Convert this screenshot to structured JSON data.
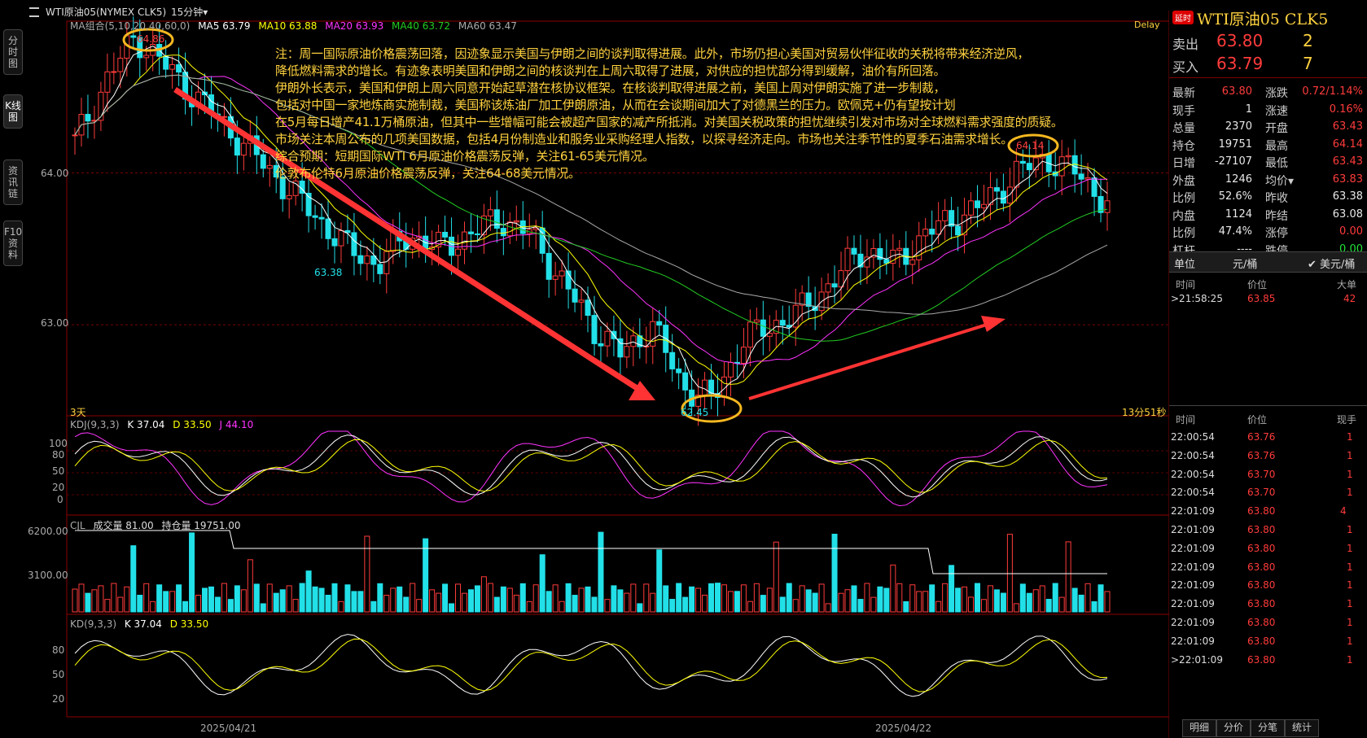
{
  "topbar": {
    "icon": "menu-icon",
    "instrument": "WTI原油05(NYMEX CLK5)",
    "period": "15分钟▾"
  },
  "side_tabs": [
    "分时图",
    "K线图",
    "资讯链",
    "F10资料"
  ],
  "indicators": {
    "ma_name": "MA组合(5,10,20,40,60,0)",
    "ma5": "MA5 63.79",
    "ma10": "MA10 63.88",
    "ma20": "MA20 63.93",
    "ma40": "MA40 63.72",
    "ma60": "MA60 63.47",
    "delay": "Delay",
    "kdj": "KDJ(9,3,3)",
    "kdj_k": "K 37.04",
    "kdj_d": "D 33.50",
    "kdj_j": "J 44.10",
    "cjl": "CJL",
    "cjl_vol": "成交量 81.00",
    "cjl_oi": "持仓量 19751.00",
    "kd": "KD(9,3,3)",
    "kd_k": "K 37.04",
    "kd_d": "D 33.50"
  },
  "notes": [
    "注：周一国际原油价格震荡回落，因迹象显示美国与伊朗之间的谈判取得进展。此外，市场仍担心美国对贸易伙伴征收的关税将带来经济逆风，",
    "降低燃料需求的增长。有迹象表明美国和伊朗之间的核谈判在上周六取得了进展，对供应的担忧部分得到缓解，油价有所回落。",
    "伊朗外长表示，美国和伊朗上周六同意开始起草潜在核协议框架。在核谈判取得进展之前，美国上周对伊朗实施了进一步制裁，",
    "包括对中国一家地炼商实施制裁，美国称该炼油厂加工伊朗原油，从而在会谈期间加大了对德黑兰的压力。欧佩克+仍有望按计划",
    "在5月每日增产41.1万桶原油，但其中一些增幅可能会被超产国家的减产所抵消。对美国关税政策的担忧继续引发对市场对全球燃料需求强度的质疑。",
    "市场关注本周公布的几项美国数据，包括4月份制造业和服务业采购经理人指数，以探寻经济走向。市场也关注季节性的夏季石油需求增长。",
    "综合预期：短期国际WTI 6月原油价格震荡反弹，关注61-65美元情况。",
    "伦敦布伦特6月原油价格震荡反弹，关注64-68美元情况。"
  ],
  "annotations": {
    "high1": "64.86",
    "low1": "63.38",
    "low2": "62.45",
    "high2": "64.14"
  },
  "axis": {
    "price_ticks": [
      "64.00",
      "63.00"
    ],
    "kdj_ticks": [
      "100",
      "80",
      "50",
      "20",
      "0"
    ],
    "vol_ticks": [
      "6200.00",
      "3100.00"
    ],
    "kd_ticks": [
      "80",
      "50",
      "20"
    ],
    "dates": [
      "2025/04/21",
      "2025/04/22"
    ],
    "left_label": "3天",
    "countdown": "13分51秒"
  },
  "quote": {
    "badge": "延时",
    "title": "WTI原油05  CLK5",
    "sell_label": "卖出",
    "sell_price": "63.80",
    "sell_qty": "2",
    "buy_label": "买入",
    "buy_price": "63.79",
    "buy_qty": "7",
    "rows": [
      [
        "最新",
        "63.80",
        "涨跌",
        "0.72/1.14%"
      ],
      [
        "现手",
        "1",
        "涨速",
        "0.16%"
      ],
      [
        "总量",
        "2370",
        "开盘",
        "63.43"
      ],
      [
        "持仓",
        "19751",
        "最高",
        "64.14"
      ],
      [
        "日增",
        "-27107",
        "最低",
        "63.43"
      ],
      [
        "外盘",
        "1246",
        "均价▾",
        "63.83"
      ],
      [
        "比例",
        "52.6%",
        "昨收",
        "63.38"
      ],
      [
        "内盘",
        "1124",
        "昨结",
        "63.08"
      ],
      [
        "比例",
        "47.4%",
        "涨停",
        "0.00"
      ],
      [
        "杠杆",
        "----",
        "跌停",
        "0.00"
      ]
    ],
    "unit_label": "单位",
    "unit_value": "元/桶",
    "currency": "✔ 美元/桶",
    "big_header": [
      "时间",
      "价位",
      "大单"
    ],
    "big_rows": [
      [
        ">21:58:25",
        "63.85",
        "42"
      ]
    ],
    "tick_header": [
      "时间",
      "价位",
      "现手"
    ],
    "ticks": [
      [
        "22:00:54",
        "63.76",
        "1"
      ],
      [
        "22:00:54",
        "63.76",
        "1"
      ],
      [
        "22:00:54",
        "63.70",
        "1"
      ],
      [
        "22:00:54",
        "63.70",
        "1"
      ],
      [
        "22:01:09",
        "63.80",
        "4"
      ],
      [
        "22:01:09",
        "63.80",
        "1"
      ],
      [
        "22:01:09",
        "63.80",
        "1"
      ],
      [
        "22:01:09",
        "63.80",
        "1"
      ],
      [
        "22:01:09",
        "63.80",
        "1"
      ],
      [
        "22:01:09",
        "63.80",
        "1"
      ],
      [
        "22:01:09",
        "63.80",
        "1"
      ],
      [
        "22:01:09",
        "63.80",
        "1"
      ],
      [
        ">22:01:09",
        "63.80",
        "1"
      ]
    ],
    "bottom_tabs": [
      "明细",
      "分价",
      "分笔",
      "统计"
    ]
  },
  "chart_data": {
    "type": "candlestick",
    "price_range": [
      62.4,
      65.0
    ],
    "ohlc_sample_closes": [
      64.2,
      64.6,
      64.9,
      64.7,
      64.5,
      64.3,
      64.1,
      63.9,
      63.7,
      63.5,
      63.4,
      63.6,
      63.5,
      63.6,
      63.7,
      63.6,
      63.3,
      63.0,
      62.8,
      63.0,
      62.6,
      62.5,
      62.9,
      63.0,
      63.1,
      63.3,
      63.5,
      63.4,
      63.6,
      63.7,
      63.8,
      64.0,
      64.1,
      64.0,
      63.8
    ],
    "series": [
      {
        "name": "MA5",
        "last": 63.79
      },
      {
        "name": "MA10",
        "last": 63.88
      },
      {
        "name": "MA20",
        "last": 63.93
      },
      {
        "name": "MA40",
        "last": 63.72
      },
      {
        "name": "MA60",
        "last": 63.47
      }
    ],
    "colors": {
      "up": "#ff3b3b",
      "down": "#22e0e8",
      "ma5": "#ffffff",
      "ma10": "#ffff00",
      "ma20": "#ff33ff",
      "ma40": "#22cc22",
      "ma60": "#aaaaaa",
      "arrow": "#ff3333",
      "note": "#ffd23f",
      "circle": "#f5b820"
    }
  }
}
